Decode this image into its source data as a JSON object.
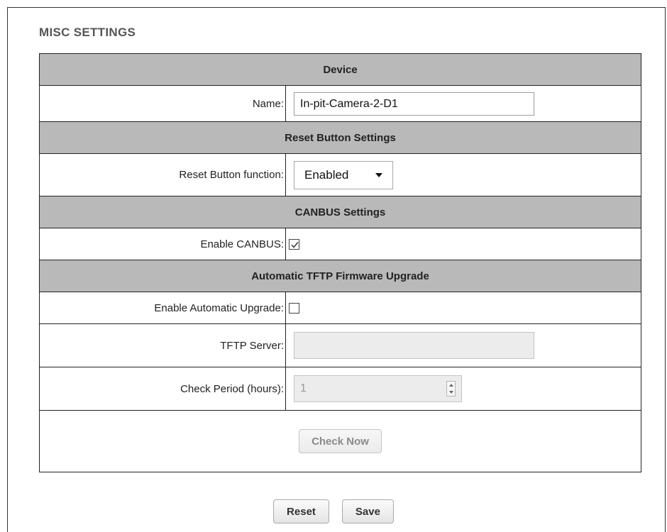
{
  "page": {
    "heading": "MISC SETTINGS"
  },
  "sections": {
    "device": {
      "title": "Device",
      "name_label": "Name:",
      "name_value": "In-pit-Camera-2-D1"
    },
    "reset_button": {
      "title": "Reset Button Settings",
      "function_label": "Reset Button function:",
      "function_value": "Enabled"
    },
    "canbus": {
      "title": "CANBUS Settings",
      "enable_label": "Enable CANBUS:",
      "enable_checked": true
    },
    "tftp": {
      "title": "Automatic TFTP Firmware Upgrade",
      "auto_label": "Enable Automatic Upgrade:",
      "auto_checked": false,
      "server_label": "TFTP Server:",
      "server_value": "",
      "period_label": "Check Period (hours):",
      "period_value": "1",
      "check_now_label": "Check Now"
    }
  },
  "footer": {
    "reset_label": "Reset",
    "save_label": "Save"
  },
  "colors": {
    "section_header_bg": "#b9b9b9",
    "disabled_input_bg": "#ececec"
  }
}
